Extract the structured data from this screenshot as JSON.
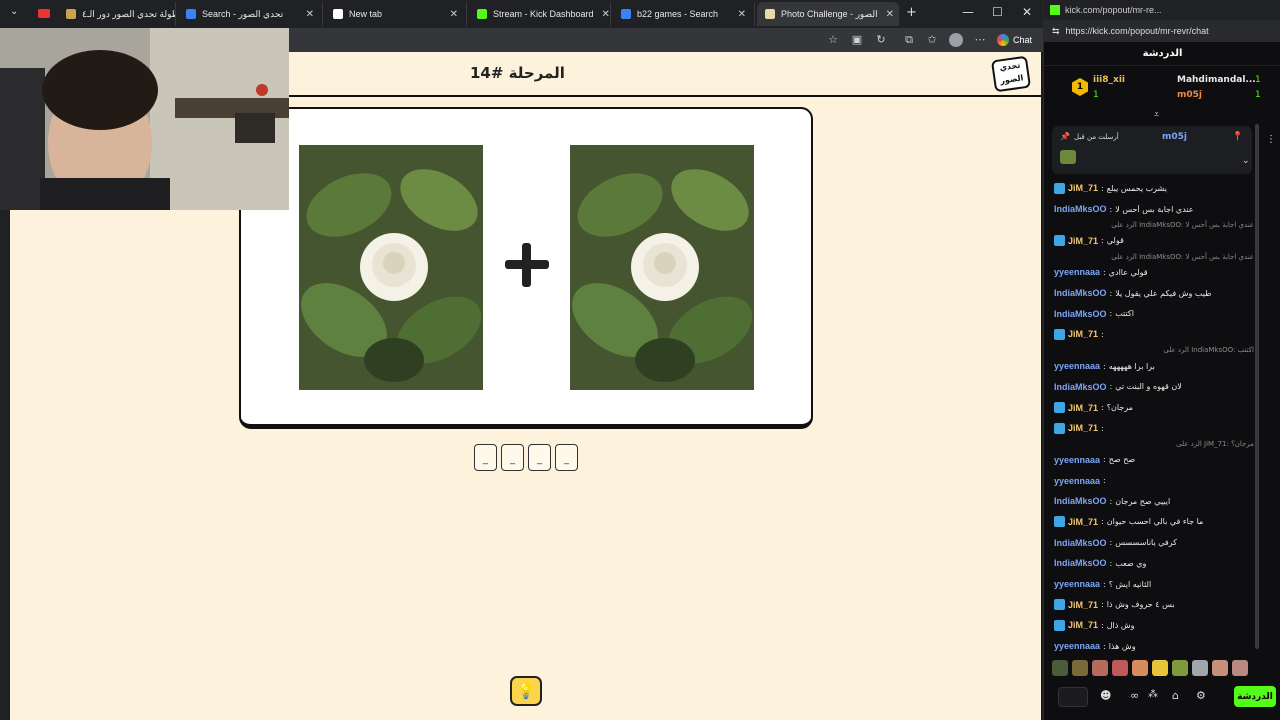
{
  "browser": {
    "tabs": [
      {
        "label": "بطولة تحدي الصور دور الـ٤",
        "active": false
      },
      {
        "label": "Search - تحدي الصور",
        "active": false
      },
      {
        "label": "New tab",
        "active": false
      },
      {
        "label": "Stream - Kick Dashboard",
        "active": false
      },
      {
        "label": "b22 games - Search",
        "active": false
      },
      {
        "label": "Photo Challenge - الصور",
        "active": true
      }
    ],
    "chat_button_label": "Chat"
  },
  "game": {
    "level_title": "المرحلة #14",
    "logo_text": "تحدي الصور",
    "answer_slots": [
      "_",
      "_",
      "_",
      "_"
    ],
    "hint_icon": "lightbulb-icon"
  },
  "chat_window": {
    "title_url": "kick.com/popout/mr-re...",
    "url": "https://kick.com/popout/mr-revr/chat",
    "header": "الدردشة",
    "leaderboard": [
      {
        "rank": "1",
        "name": "iii8_xii",
        "count": "1"
      },
      {
        "name": "Mahdimandal...",
        "count": "1"
      },
      {
        "name": "m05j",
        "count": "1"
      }
    ],
    "pinned": {
      "name": "m05j",
      "text": "أرسلت من قبل"
    },
    "messages": [
      {
        "user": "JiM_71",
        "color": "#f0c674",
        "text": "يشرب يحمس يبلع",
        "badge": true
      },
      {
        "user": "IndiaMksOO",
        "color": "#7aa6f7",
        "text": "عندي اجابة بس أحس لا"
      },
      {
        "reply": "الرد على IndiaMksOO: عندي اجابة بس أحس لا"
      },
      {
        "user": "JiM_71",
        "color": "#f0c674",
        "text": "قولي",
        "badge": true
      },
      {
        "reply": "الرد على IndiaMksOO: عندي اجابة بس أحس لا"
      },
      {
        "user": "yyeennaaa",
        "color": "#7aa6f7",
        "text": "قولي عاادي"
      },
      {
        "user": "IndiaMksOO",
        "color": "#7aa6f7",
        "text": "طيب وش فيكم علي يقول يلا"
      },
      {
        "user": "IndiaMksOO",
        "color": "#7aa6f7",
        "text": "اكتتب"
      },
      {
        "user": "JiM_71",
        "color": "#f0c674",
        "text": "",
        "badge": true
      },
      {
        "reply": "الرد على IndiaMksOO: اكتتب"
      },
      {
        "user": "yyeennaaa",
        "color": "#7aa6f7",
        "text": "برا برا هههههه"
      },
      {
        "user": "IndiaMksOO",
        "color": "#7aa6f7",
        "text": "لان قهوه و البنت تي"
      },
      {
        "user": "JiM_71",
        "color": "#f0c674",
        "text": "مرجان؟",
        "badge": true
      },
      {
        "user": "JiM_71",
        "color": "#f0c674",
        "text": "",
        "badge": true
      },
      {
        "reply": "الرد على JiM_71: مرجان؟"
      },
      {
        "user": "yyeennaaa",
        "color": "#7aa6f7",
        "text": "صح صح"
      },
      {
        "user": "yyeennaaa",
        "color": "#7aa6f7",
        "text": ""
      },
      {
        "user": "IndiaMksOO",
        "color": "#7aa6f7",
        "text": "ايييي صح مرجان"
      },
      {
        "user": "JiM_71",
        "color": "#f0c674",
        "text": "ما جاء في بالي احسب حيوان",
        "badge": true
      },
      {
        "user": "IndiaMksOO",
        "color": "#7aa6f7",
        "text": "كرفي ياناسسسس"
      },
      {
        "user": "IndiaMksOO",
        "color": "#7aa6f7",
        "text": "وي صعب"
      },
      {
        "user": "yyeennaaa",
        "color": "#7aa6f7",
        "text": "الثانيه ايش ؟"
      },
      {
        "user": "JiM_71",
        "color": "#f0c674",
        "text": "بس ٤ حروف وش ذا",
        "badge": true
      },
      {
        "user": "JiM_71",
        "color": "#f0c674",
        "text": "وش ذال",
        "badge": true
      },
      {
        "user": "yyeennaaa",
        "color": "#7aa6f7",
        "text": "وش هذا"
      }
    ],
    "send_label": "الدردشة"
  },
  "colors": {
    "page_bg": "#fdf3dc",
    "kick_green": "#53fc18",
    "hint_yellow": "#fbd34d"
  }
}
